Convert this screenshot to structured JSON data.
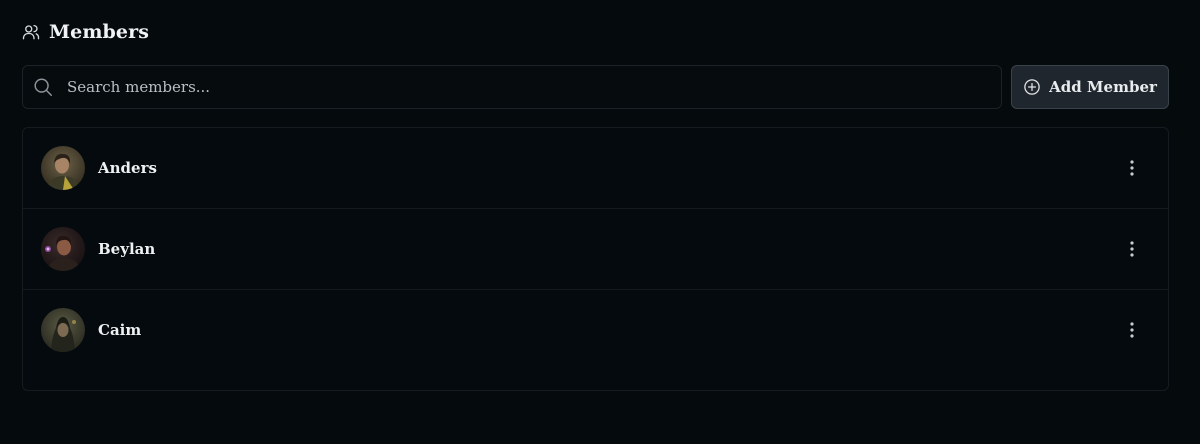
{
  "header": {
    "title": "Members",
    "icon": "users-icon"
  },
  "search": {
    "placeholder": "Search members...",
    "value": "",
    "icon": "search-icon"
  },
  "add_button": {
    "label": "Add Member",
    "icon": "plus-circle-icon"
  },
  "members": [
    {
      "name": "Anders",
      "avatar": "avatar-anders",
      "menu_icon": "more-vertical-icon"
    },
    {
      "name": "Beylan",
      "avatar": "avatar-beylan",
      "menu_icon": "more-vertical-icon"
    },
    {
      "name": "Caim",
      "avatar": "avatar-caim",
      "menu_icon": "more-vertical-icon"
    }
  ],
  "colors": {
    "background": "#050a0d",
    "button_bg": "#1f262d",
    "border": "#1b2328",
    "text": "#eef0f2"
  }
}
